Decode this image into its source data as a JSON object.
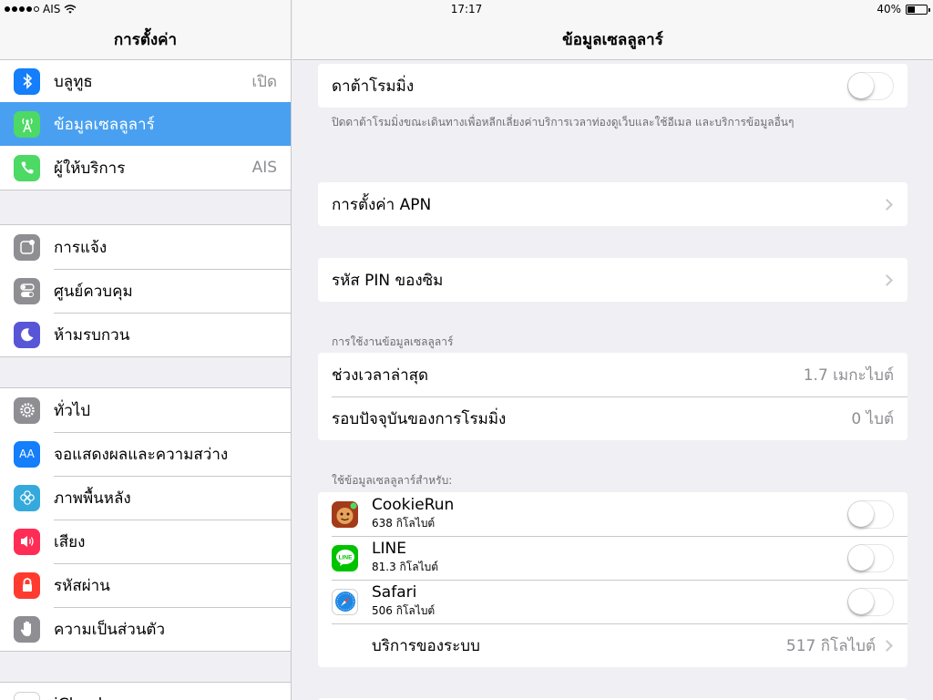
{
  "status": {
    "carrier": "AIS",
    "time": "17:17",
    "battery": "40%",
    "battery_level": 0.4
  },
  "sidebar": {
    "title": "การตั้งค่า",
    "items": [
      {
        "label": "บลูทูธ",
        "value": "เปิด",
        "icon": "bluetooth-icon",
        "color": "#147efb"
      },
      {
        "label": "ข้อมูลเซลลูลาร์",
        "value": "",
        "icon": "cellular-icon",
        "color": "#4cd964"
      },
      {
        "label": "ผู้ให้บริการ",
        "value": "AIS",
        "icon": "phone-icon",
        "color": "#4cd964"
      },
      {
        "label": "การแจ้ง",
        "value": "",
        "icon": "notification-icon",
        "color": "#8e8e93"
      },
      {
        "label": "ศูนย์ควบคุม",
        "value": "",
        "icon": "control-center-icon",
        "color": "#8e8e93"
      },
      {
        "label": "ห้ามรบกวน",
        "value": "",
        "icon": "moon-icon",
        "color": "#5856d6"
      },
      {
        "label": "ทั่วไป",
        "value": "",
        "icon": "gear-icon",
        "color": "#8e8e93"
      },
      {
        "label": "จอแสดงผลและความสว่าง",
        "value": "",
        "icon": "display-icon",
        "color": "#147efb",
        "glyph": "AA"
      },
      {
        "label": "ภาพพื้นหลัง",
        "value": "",
        "icon": "wallpaper-icon",
        "color": "#34aadc"
      },
      {
        "label": "เสียง",
        "value": "",
        "icon": "speaker-icon",
        "color": "#ff2d55"
      },
      {
        "label": "รหัสผ่าน",
        "value": "",
        "icon": "lock-icon",
        "color": "#ff3b30"
      },
      {
        "label": "ความเป็นส่วนตัว",
        "value": "",
        "icon": "hand-icon",
        "color": "#8e8e93"
      },
      {
        "label": "iCloud",
        "value": "",
        "icon": "cloud-icon",
        "color": "#ffffff"
      }
    ]
  },
  "main": {
    "title": "ข้อมูลเซลลูลาร์",
    "roaming_label": "ดาต้าโรมมิ่ง",
    "roaming_on": false,
    "roaming_footer": "ปิดดาต้าโรมมิ่งขณะเดินทางเพื่อหลีกเลี่ยงค่าบริการเวลาท่องดูเว็บและใช้อีเมล และบริการข้อมูลอื่นๆ",
    "apn_label": "การตั้งค่า APN",
    "pin_label": "รหัส PIN ของซิม",
    "usage_header": "การใช้งานข้อมูลเซลลูลาร์",
    "usage": [
      {
        "label": "ช่วงเวลาล่าสุด",
        "value": "1.7 เมกะไบต์"
      },
      {
        "label": "รอบปัจจุบันของการโรมมิ่ง",
        "value": "0 ไบต์"
      }
    ],
    "apps_header": "ใช้ข้อมูลเซลลูลาร์สำหรับ:",
    "apps": [
      {
        "name": "CookieRun",
        "size": "638 กิโลไบต์",
        "icon": "cookierun-icon",
        "color": "#d9662a",
        "on": false
      },
      {
        "name": "LINE",
        "size": "81.3 กิโลไบต์",
        "icon": "line-icon",
        "color": "#00c300",
        "on": false
      },
      {
        "name": "Safari",
        "size": "506 กิโลไบต์",
        "icon": "safari-icon",
        "color": "#1e88e5",
        "on": false
      }
    ],
    "system_label": "บริการของระบบ",
    "system_value": "517 กิโลไบต์"
  }
}
